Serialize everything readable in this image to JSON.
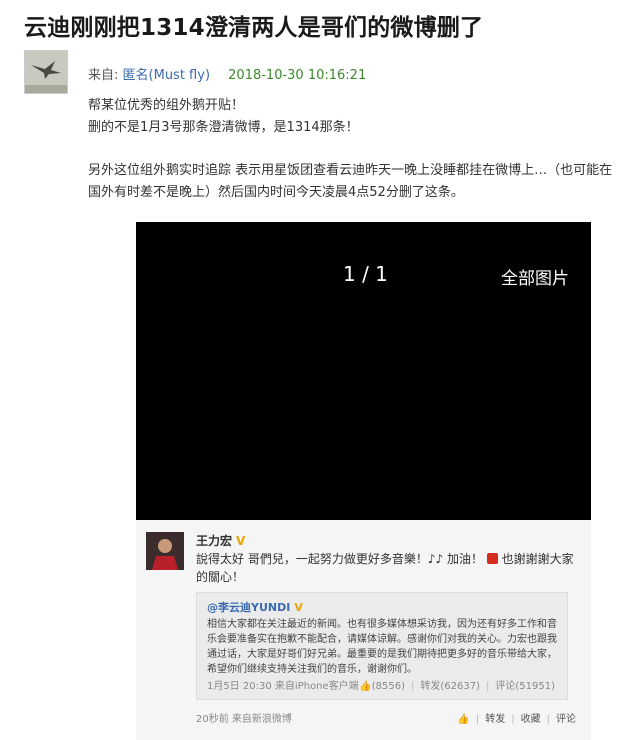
{
  "post": {
    "title": "云迪刚刚把1314澄清两人是哥们的微博删了",
    "from_label": "来自:",
    "author": "匿名(Must fly)",
    "date": "2018-10-30 10:16:21",
    "lines": [
      "帮某位优秀的组外鹅开贴！",
      "删的不是1月3号那条澄清微博，是1314那条！"
    ],
    "paragraph2": "另外这位组外鹅实时追踪 表示用星饭团查看云迪昨天一晚上没睡都挂在微博上…（也可能在国外有时差不是晚上）然后国内时间今天凌晨4点52分删了这条。"
  },
  "viewer": {
    "counter": "1 / 1",
    "all_images": "全部图片"
  },
  "weibo": {
    "username": "王力宏",
    "v_badge": "V",
    "post_text_a": "說得太好 哥們兒，一起努力做更好多音樂！♪♪ 加油！",
    "post_text_b": "也謝謝謝大家的關心！",
    "quote": {
      "username": "@李云迪YUNDI",
      "v_badge": "V",
      "text": "相信大家都在关注最近的新闻。也有很多媒体想采访我，因为还有好多工作和音乐会要准备实在抱歉不能配合，请媒体谅解。感谢你们对我的关心。力宏也跟我通过话，大家是好哥们好兄弟。最重要的是我们期待把更多好的音乐带给大家，希望你们继续支持关注我们的音乐，谢谢你们。",
      "time": "1月5日 20:30",
      "source": "来自iPhone客户端",
      "likes": "(8556)",
      "reposts": "转发(62637)",
      "comments": "评论(51951)"
    },
    "time_ago": "20秒前",
    "source": "来自新浪微博",
    "actions": {
      "repost": "转发",
      "favorite": "收藏",
      "comment": "评论"
    }
  }
}
